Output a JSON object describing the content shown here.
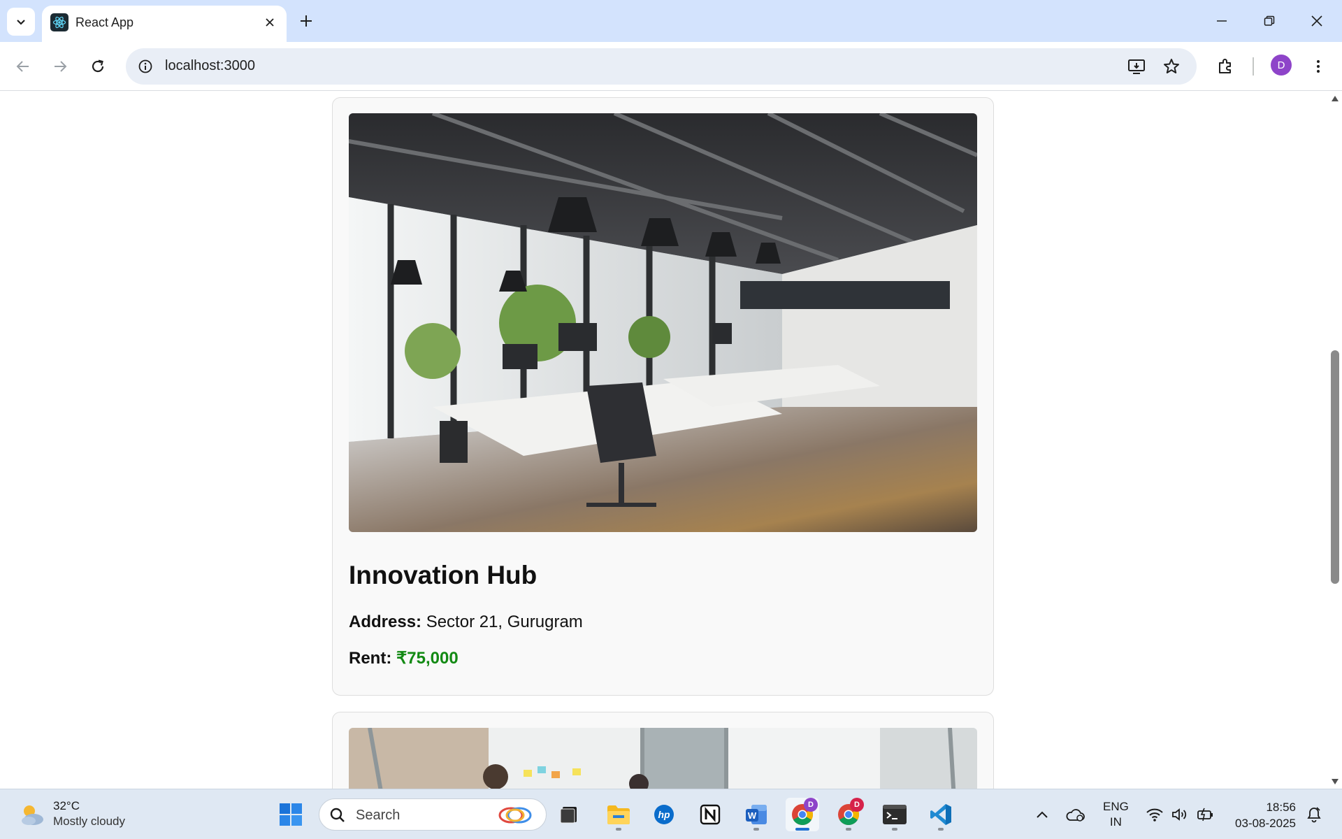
{
  "browser": {
    "tab_title": "React App",
    "url": "localhost:3000",
    "profile_initial": "D"
  },
  "cards": [
    {
      "title": "Innovation Hub",
      "address_label": "Address:",
      "address": "Sector 21, Gurugram",
      "rent_label": "Rent:",
      "rent": "₹75,000",
      "image_alt": "modern open-plan office interior with pendant lights and desks"
    },
    {
      "image_alt": "office meeting room with people and sticky notes"
    }
  ],
  "colors": {
    "rent": "#138a14",
    "tabstrip": "#d3e3fd",
    "card_bg": "#f9f9f9"
  },
  "taskbar": {
    "weather_temp": "32°C",
    "weather_condition": "Mostly cloudy",
    "search_label": "Search",
    "lang_line1": "ENG",
    "lang_line2": "IN",
    "time": "18:56",
    "date": "03-08-2025",
    "chrome_badge_1": "D",
    "chrome_badge_2": "D",
    "apps": [
      "start-icon",
      "file-explorer-icon",
      "task-view-icon",
      "hp-icon",
      "notion-icon",
      "word-icon",
      "chrome-icon",
      "chrome-icon",
      "terminal-icon",
      "vscode-icon"
    ]
  }
}
